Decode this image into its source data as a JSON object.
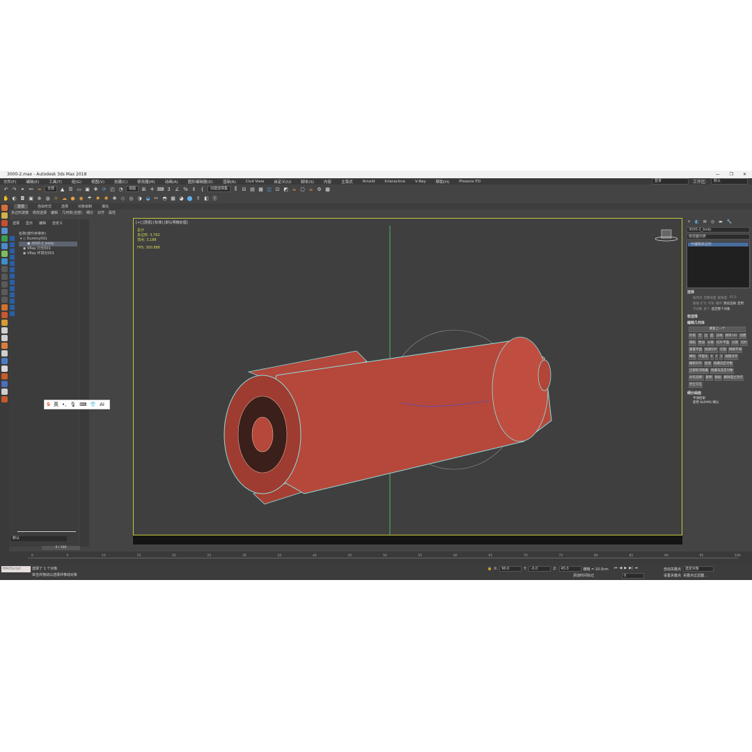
{
  "window": {
    "title": "3000-2.max - Autodesk 3ds Max 2018",
    "controls": [
      "—",
      "❐",
      "✕"
    ]
  },
  "menu": [
    "文件(F)",
    "编辑(E)",
    "工具(T)",
    "组(G)",
    "视图(V)",
    "创建(C)",
    "修改器(M)",
    "动画(A)",
    "图形编辑器(D)",
    "渲染(R)",
    "Civil View",
    "自定义(U)",
    "脚本(S)",
    "内容",
    "主菜式",
    "Arnold",
    "Interactive",
    "V-Ray",
    "帮助(H)",
    "Phoenix FD"
  ],
  "workspace": {
    "user": "登录",
    "label": "工作区:",
    "value": "默认"
  },
  "toolbar": {
    "filter": "全部",
    "view": "视图",
    "selection_set": "创建选择集"
  },
  "ribbon": {
    "tabs": [
      "建模",
      "自由形式",
      "选择",
      "对象绘制",
      "填充"
    ],
    "sub": [
      "多边形建模",
      "修改选择",
      "编辑",
      "几何体(全部)",
      "细分",
      "对齐",
      "属性"
    ]
  },
  "scene_explorer": {
    "tabs": [
      "选择",
      "显示",
      "编辑",
      "自定义"
    ],
    "header": "名称(按升序排序)",
    "items": [
      {
        "name": "Dummy001"
      },
      {
        "name": "3000-2_body"
      },
      {
        "name": "VRay 灯光001"
      },
      {
        "name": "VRay 环境光001"
      }
    ],
    "layer": "默认"
  },
  "viewport": {
    "label": "[+] [透视] [标准] [默认明暗处理]",
    "stats": {
      "title": "总计",
      "polys_label": "多边形:",
      "polys": "3,762",
      "verts_label": "顶点:",
      "verts": "3,188",
      "fps_label": "FPS:",
      "fps": "300.886"
    }
  },
  "command_panel": {
    "object_name": "3000-2_body",
    "modifier_list": "修改器列表",
    "stack_item": "可编辑多边形",
    "sections": {
      "selection": "选择",
      "soft_selection": "软选择",
      "edit_geometry": "编辑几何体",
      "subdivision": "细分曲面"
    },
    "selection_items": [
      "按顶点",
      "忽略背面",
      "按角度:",
      "45.0",
      "收缩",
      "扩大",
      "环形",
      "循环",
      "预览选择",
      "禁用",
      "子对象",
      "多个",
      "选定整个对象"
    ],
    "edit_geo_items": [
      "重复上一个",
      "约束",
      "无",
      "边",
      "面",
      "法线",
      "保持 UV",
      "创建",
      "塌陷",
      "附加",
      "分离",
      "切片平面",
      "分割",
      "切片",
      "重置平面",
      "快速切片",
      "切割",
      "网格平滑",
      "细化",
      "平面化",
      "X",
      "Y",
      "Z",
      "视图对齐",
      "栅格对齐",
      "松弛",
      "隐藏选定对象",
      "全部取消隐藏",
      "隐藏未选定对象",
      "命名选择:",
      "复制",
      "粘贴",
      "删除孤立顶点",
      "完全交互"
    ],
    "subdiv_items": [
      "平滑结果",
      "使用 NURMS 细分"
    ]
  },
  "timeline": {
    "frame": "0 / 100",
    "ticks": [
      "0",
      "5",
      "10",
      "15",
      "20",
      "25",
      "30",
      "35",
      "40",
      "45",
      "50",
      "55",
      "60",
      "65",
      "70",
      "75",
      "80",
      "85",
      "90",
      "95",
      "100"
    ]
  },
  "status": {
    "maxscript": "MAXScript",
    "selected": "选择了 1 个对象",
    "hint": "单击并拖动以选择并移动对象",
    "x_label": "X:",
    "x": "90.0",
    "y_label": "Y:",
    "y": "-0.0",
    "z_label": "Z:",
    "z": "45.0",
    "grid": "栅格 = 10.0cm",
    "add_time_tag": "添加时间标记",
    "auto_key": "自动关键点",
    "selected_objects": "选定对象",
    "set_key": "设置关键点",
    "key_filters": "关键点过滤器...",
    "frame_value": "0"
  },
  "ime": {
    "lang": "英"
  }
}
